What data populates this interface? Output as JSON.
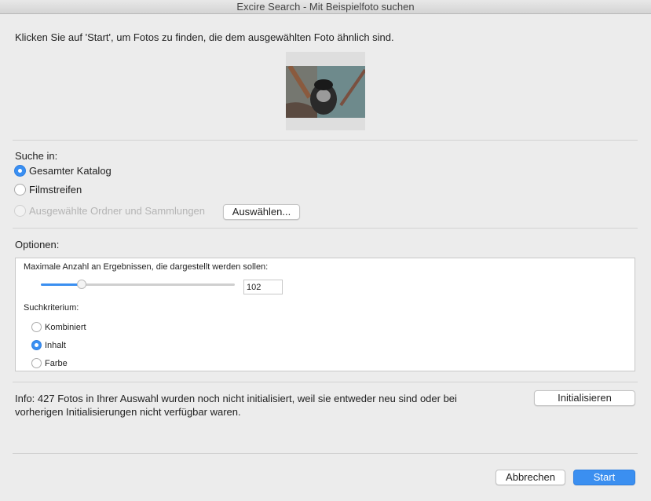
{
  "window": {
    "title": "Excire Search - Mit Beispielfoto suchen"
  },
  "instruction": "Klicken Sie auf 'Start', um Fotos zu finden, die dem ausgewählten Foto ähnlich sind.",
  "search_in": {
    "label": "Suche in:",
    "options": [
      {
        "label": "Gesamter Katalog",
        "selected": true,
        "enabled": true
      },
      {
        "label": "Filmstreifen",
        "selected": false,
        "enabled": true
      },
      {
        "label": "Ausgewählte Ordner und Sammlungen",
        "selected": false,
        "enabled": false
      }
    ],
    "select_button": "Auswählen..."
  },
  "options": {
    "label": "Optionen:",
    "max_results_label": "Maximale Anzahl an Ergebnissen, die dargestellt werden sollen:",
    "max_results_value": "102",
    "slider_fraction": 0.21,
    "criterion_label": "Suchkriterium:",
    "criteria": [
      {
        "label": "Kombiniert",
        "selected": false
      },
      {
        "label": "Inhalt",
        "selected": true
      },
      {
        "label": "Farbe",
        "selected": false
      }
    ]
  },
  "info": {
    "line1": "Info: 427 Fotos in Ihrer Auswahl wurden noch nicht initialisiert, weil sie entweder neu sind oder bei",
    "line2": "vorherigen Initialisierungen nicht verfügbar waren.",
    "button": "Initialisieren"
  },
  "footer": {
    "cancel": "Abbrechen",
    "start": "Start"
  },
  "colors": {
    "accent": "#3b8ff0"
  }
}
